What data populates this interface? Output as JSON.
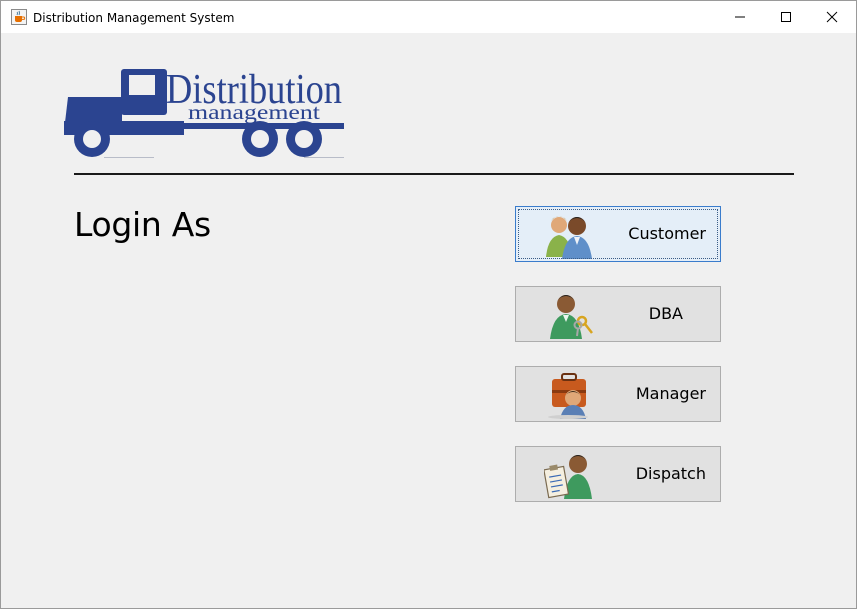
{
  "window": {
    "title": "Distribution Management System",
    "icon": "java-cup-icon",
    "controls": [
      "minimize-icon",
      "maximize-icon",
      "close-icon"
    ]
  },
  "logo": {
    "line1": "Distribution",
    "line2": "management",
    "icon": "truck-icon",
    "color": "#2b4490"
  },
  "heading": "Login As",
  "roles": [
    {
      "label": "Customer",
      "icon": "customers-pair-icon",
      "focused": true
    },
    {
      "label": "DBA",
      "icon": "user-with-keys-icon",
      "focused": false
    },
    {
      "label": "Manager",
      "icon": "user-with-briefcase-icon",
      "focused": false
    },
    {
      "label": "Dispatch",
      "icon": "user-with-clipboard-icon",
      "focused": false
    }
  ]
}
